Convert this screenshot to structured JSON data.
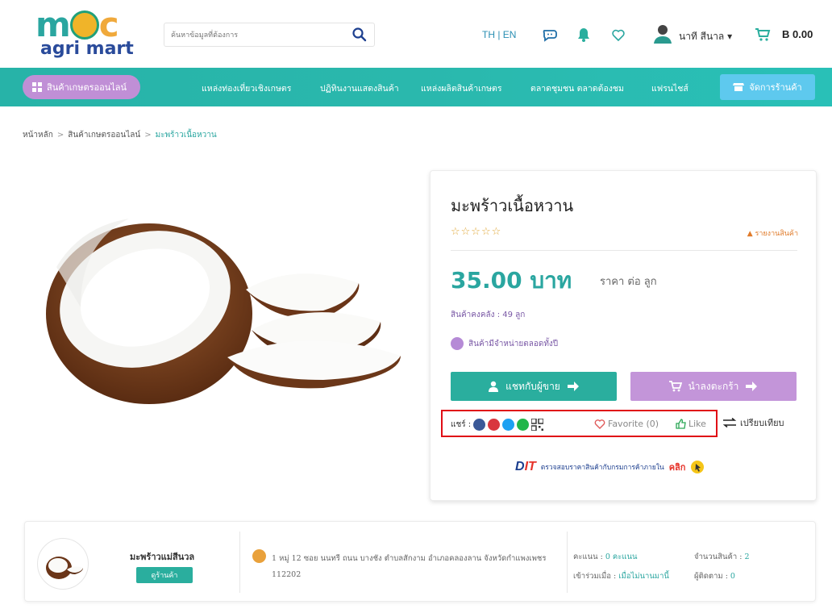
{
  "header": {
    "logo_main": "m",
    "logo_end": "c",
    "logo_sub": "agri mart",
    "search_placeholder": "ค้นหาข้อมูลที่ต้องการ",
    "lang": "TH | EN",
    "user_name": "นาที สีนาล ▾",
    "cart_total": "B 0.00"
  },
  "nav": {
    "category": "สินค้าเกษตรออนไลน์",
    "items": [
      "แหล่งท่องเที่ยวเชิงเกษตร",
      "ปฏิทินงานแสดงสินค้า",
      "แหล่งผลิตสินค้าเกษตร",
      "ตลาดชุมชน ตลาดต้องชม",
      "แฟรนไชส์"
    ],
    "shop_manage": "จัดการร้านค้า"
  },
  "breadcrumb": [
    "หน้าหลัก",
    "สินค้าเกษตรออนไลน์",
    "มะพร้าวเนื้อหวาน"
  ],
  "product": {
    "title": "มะพร้าวเนื้อหวาน",
    "stars": "☆☆☆☆☆",
    "report": "รายงานสินค้า",
    "price": "35.00 บาท",
    "unit": "ราคา ต่อ ลูก",
    "stock_label": "สินค้าคงคลัง : ",
    "stock_value": "49 ลูก",
    "availability": "สินค้ามีจำหน่ายตลอดทั้งปี",
    "chat_button": "แชทกับผู้ขาย",
    "cart_button": "นำลงตะกร้า",
    "share_label": "แชร์ :",
    "favorite": "Favorite (0)",
    "like": "Like",
    "compare": "เปรียบเทียบ",
    "dit_logo_d": "D",
    "dit_logo_t": "IT",
    "dit_text": "ตรวจสอบราคาสินค้ากับกรมการค้าภายใน",
    "dit_click": "คลิก"
  },
  "shop": {
    "name": "มะพร้าวแม่สีนวล",
    "button": "ดูร้านค้า",
    "address": "1 หมู่ 12 ซอย นนทรี ถนน บางชัง ตำบลสักงาม อำเภอคลองลาน จังหวัดกำแพงเพชร 112202",
    "score_label": "คะแนน : ",
    "score_value": "0 คะแนน",
    "product_count_label": "จำนวนสินค้า : ",
    "product_count_value": "2",
    "joined_label": "เข้าร่วมเมื่อ : ",
    "joined_value": "เมื่อไม่นานมานี้",
    "followers_label": "ผู้ติดตาม : ",
    "followers_value": "0"
  },
  "colors": {
    "teal": "#2aa6a0",
    "purple": "#c395d9",
    "highlight_red": "#e00d16"
  }
}
